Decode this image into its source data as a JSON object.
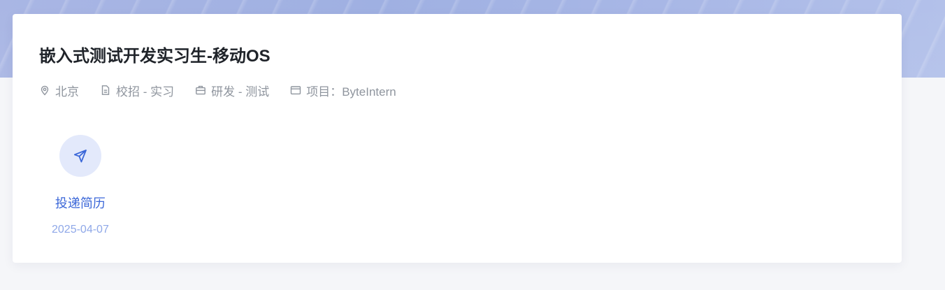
{
  "job": {
    "title": "嵌入式测试开发实习生-移动OS",
    "meta": [
      {
        "icon": "location-pin-icon",
        "text": "北京"
      },
      {
        "icon": "document-icon",
        "text": "校招 - 实习"
      },
      {
        "icon": "briefcase-icon",
        "text": "研发 - 测试"
      },
      {
        "icon": "project-card-icon",
        "text": "项目：ByteIntern"
      }
    ]
  },
  "apply": {
    "icon": "send-icon",
    "label": "投递简历",
    "date": "2025-04-07"
  },
  "colors": {
    "accent": "#3b67d8",
    "accent_light": "#e3e9fb",
    "date": "#8fa8e8",
    "meta_text": "#8f959e",
    "title_text": "#1f2329"
  }
}
